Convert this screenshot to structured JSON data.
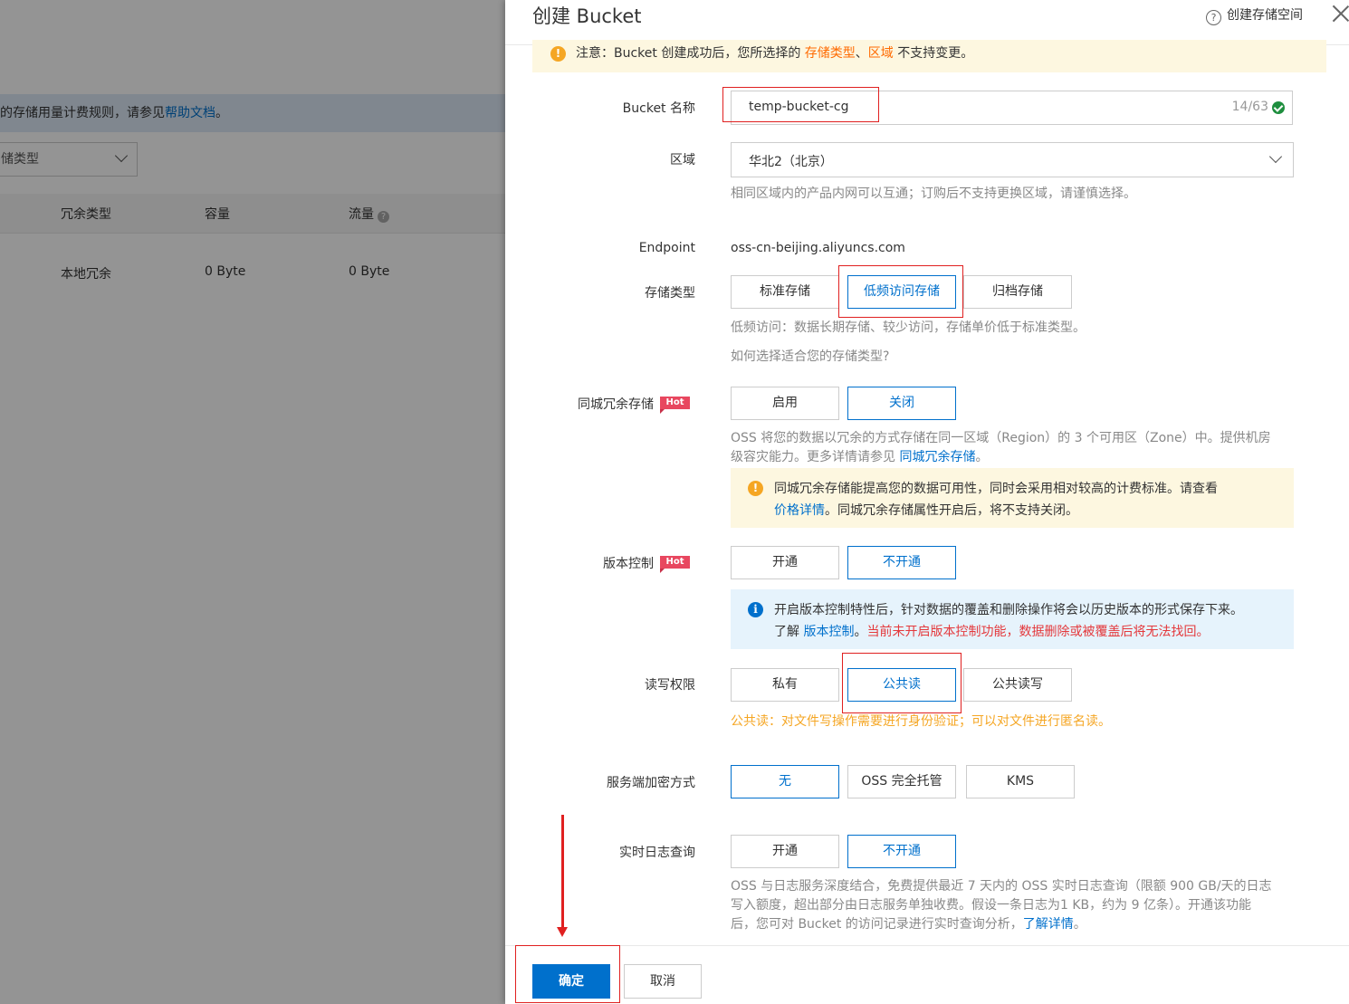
{
  "background": {
    "notice_text": "的存储用量计费规则，请参见",
    "notice_link": "帮助文档",
    "notice_end": "。",
    "filter_select": "储类型",
    "columns": [
      "冗余类型",
      "容量",
      "流量"
    ],
    "row": {
      "redundancy": "本地冗余",
      "capacity": "0 Byte",
      "traffic": "0 Byte"
    }
  },
  "drawer": {
    "title": "创建 Bucket",
    "help_link": "创建存储空间",
    "warning": {
      "prefix": "注意：Bucket 创建成功后，您所选择的 ",
      "storage_type": "存储类型",
      "sep": "、",
      "region": "区域",
      "suffix": " 不支持变更。"
    },
    "bucket_name": {
      "label": "Bucket 名称",
      "value": "temp-bucket-cg",
      "counter": "14/63"
    },
    "region": {
      "label": "区域",
      "value": "华北2（北京）",
      "hint": "相同区域内的产品内网可以互通；订购后不支持更换区域，请谨慎选择。"
    },
    "endpoint": {
      "label": "Endpoint",
      "value": "oss-cn-beijing.aliyuncs.com"
    },
    "storage_class": {
      "label": "存储类型",
      "options": [
        "标准存储",
        "低频访问存储",
        "归档存储"
      ],
      "selected": "低频访问存储",
      "hint": "低频访问：数据长期存储、较少访问，存储单价低于标准类型。",
      "link": "如何选择适合您的存储类型?"
    },
    "zrs": {
      "label": "同城冗余存储",
      "badge": "Hot",
      "options": [
        "启用",
        "关闭"
      ],
      "selected": "关闭",
      "desc_line1": "OSS 将您的数据以冗余的方式存储在同一区域（Region）的 3 个可用区（Zone）中。提供机房",
      "desc_line2_prefix": "级容灾能力。更多详情请参见 ",
      "desc_link": "同城冗余存储",
      "desc_line2_suffix": "。",
      "notice_line1": "同城冗余存储能提高您的数据可用性，同时会采用相对较高的计费标准。请查看",
      "notice_link": "价格详情",
      "notice_line2": "。同城冗余存储属性开启后，将不支持关闭。"
    },
    "versioning": {
      "label": "版本控制",
      "badge": "Hot",
      "options": [
        "开通",
        "不开通"
      ],
      "selected": "不开通",
      "info_line1": "开启版本控制特性后，针对数据的覆盖和删除操作将会以历史版本的形式保存下来。",
      "info_prefix": "了解 ",
      "info_link": "版本控制",
      "info_sep": "。",
      "info_warn": "当前未开启版本控制功能，数据删除或被覆盖后将无法找回。"
    },
    "acl": {
      "label": "读写权限",
      "options": [
        "私有",
        "公共读",
        "公共读写"
      ],
      "selected": "公共读",
      "hint": "公共读：对文件写操作需要进行身份验证；可以对文件进行匿名读。"
    },
    "encryption": {
      "label": "服务端加密方式",
      "options": [
        "无",
        "OSS 完全托管",
        "KMS"
      ],
      "selected": "无"
    },
    "realtime_log": {
      "label": "实时日志查询",
      "options": [
        "开通",
        "不开通"
      ],
      "selected": "不开通",
      "desc_line1": "OSS 与日志服务深度结合，免费提供最近 7 天内的 OSS 实时日志查询（限额 900 GB/天的日志",
      "desc_line2": "写入额度，超出部分由日志服务单独收费。假设一条日志为1 KB，约为 9 亿条）。开通该功能",
      "desc_line3_prefix": "后，您可对 Bucket 的访问记录进行实时查询分析，",
      "desc_link": "了解详情",
      "desc_line3_suffix": "。"
    },
    "footer": {
      "confirm": "确定",
      "cancel": "取消"
    }
  },
  "colors": {
    "accent": "#0070cc",
    "annotation": "#e02020",
    "warning": "#f5a623",
    "hot": "#e8475f"
  }
}
